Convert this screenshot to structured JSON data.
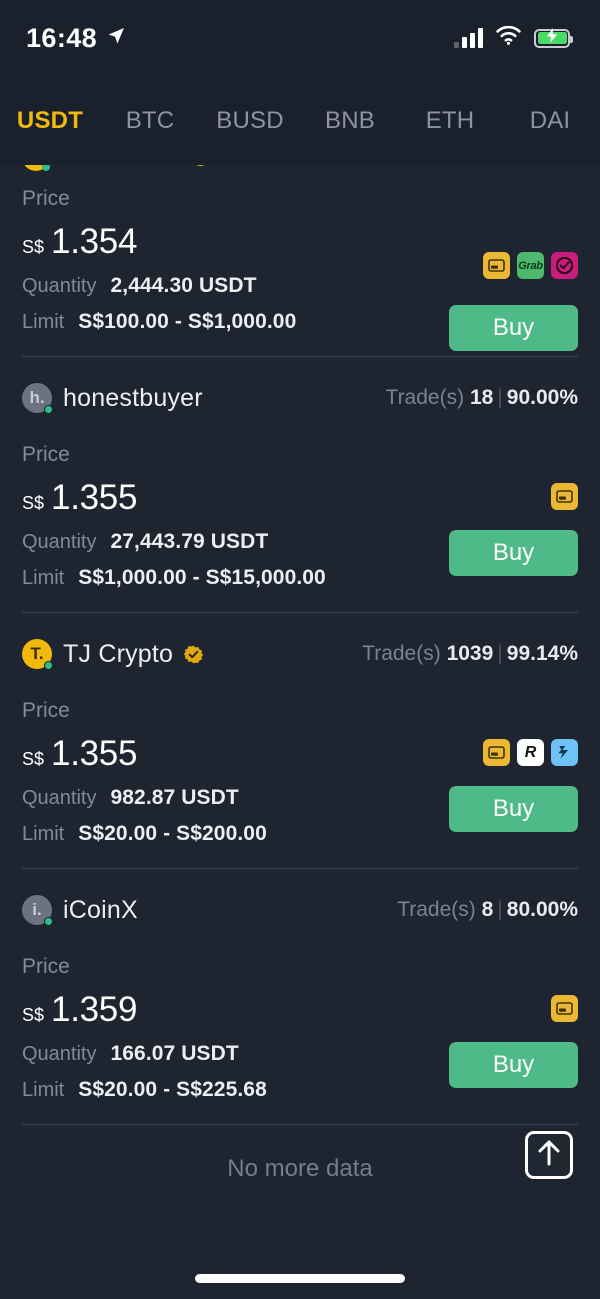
{
  "status_bar": {
    "time": "16:48",
    "location_icon": "location-arrow-icon",
    "signal_icon": "cellular-signal-icon",
    "wifi_icon": "wifi-icon",
    "battery_icon": "battery-charging-icon"
  },
  "tabs": [
    {
      "label": "USDT",
      "active": true
    },
    {
      "label": "BTC",
      "active": false
    },
    {
      "label": "BUSD",
      "active": false
    },
    {
      "label": "BNB",
      "active": false
    },
    {
      "label": "ETH",
      "active": false
    },
    {
      "label": "DAI",
      "active": false
    }
  ],
  "labels": {
    "price": "Price",
    "quantity": "Quantity",
    "limit": "Limit",
    "trades_prefix": "Trade(s)",
    "buy": "Buy",
    "currency": "S$"
  },
  "clipped_row": {
    "name_fragment": "",
    "trades_fragment": ""
  },
  "offers": [
    {
      "name": "",
      "avatar_letter": "",
      "avatar_color": "gold",
      "verified": true,
      "trades": "",
      "completion": "",
      "price": "1.354",
      "currency": "S$",
      "quantity": "2,444.30 USDT",
      "limit": "S$100.00 - S$1,000.00",
      "payments": [
        "card",
        "grab",
        "paynow"
      ],
      "buy_label": "Buy",
      "clipped": true
    },
    {
      "name": "honestbuyer",
      "avatar_letter": "h.",
      "avatar_color": "gray",
      "verified": false,
      "trades": "18",
      "completion": "90.00%",
      "price": "1.355",
      "currency": "S$",
      "quantity": "27,443.79 USDT",
      "limit": "S$1,000.00 - S$15,000.00",
      "payments": [
        "card"
      ],
      "buy_label": "Buy",
      "clipped": false
    },
    {
      "name": "TJ Crypto",
      "avatar_letter": "T.",
      "avatar_color": "gold",
      "verified": true,
      "trades": "1039",
      "completion": "99.14%",
      "price": "1.355",
      "currency": "S$",
      "quantity": "982.87 USDT",
      "limit": "S$20.00 - S$200.00",
      "payments": [
        "card",
        "revolut",
        "wise"
      ],
      "buy_label": "Buy",
      "clipped": false
    },
    {
      "name": "iCoinX",
      "avatar_letter": "i.",
      "avatar_color": "gray",
      "verified": false,
      "trades": "8",
      "completion": "80.00%",
      "price": "1.359",
      "currency": "S$",
      "quantity": "166.07 USDT",
      "limit": "S$20.00 - S$225.68",
      "payments": [
        "card"
      ],
      "buy_label": "Buy",
      "clipped": false
    }
  ],
  "footer": {
    "no_more_data": "No more data"
  },
  "scroll_top_button": {
    "icon": "arrow-up-icon"
  },
  "payment_labels": {
    "card": "",
    "grab": "Grab",
    "paynow": "",
    "revolut": "R",
    "wise": ""
  },
  "colors": {
    "background": "#1e2430",
    "header_background": "#1b212c",
    "accent_yellow": "#f0b90b",
    "buy_green": "#4eba88",
    "online_green": "#2ebd85",
    "muted_text": "#838997",
    "primary_text": "#eceef1",
    "divider": "#3a4150"
  }
}
